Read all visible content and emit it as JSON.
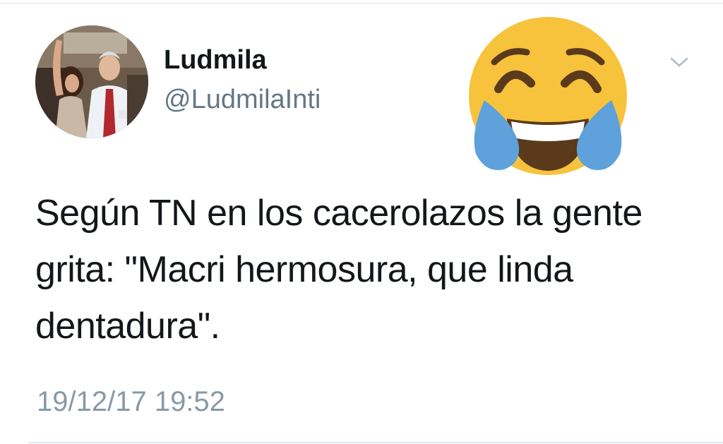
{
  "tweet": {
    "display_name": "Ludmila",
    "handle": "@LudmilaInti",
    "text": "Según TN en los cacerolazos la gente grita: \"Macri hermosura, que linda dentadura\".",
    "timestamp": "19/12/17 19:52"
  },
  "icons": {
    "menu": "chevron-down-icon",
    "overlay_emoji": "face-with-tears-of-joy-icon"
  },
  "colors": {
    "handle": "#657786",
    "timestamp": "#8899a6",
    "emoji_face": "#f7c23c",
    "emoji_tears": "#5ea1db",
    "emoji_features": "#5a3a1b",
    "divider": "#e1e8ed"
  }
}
